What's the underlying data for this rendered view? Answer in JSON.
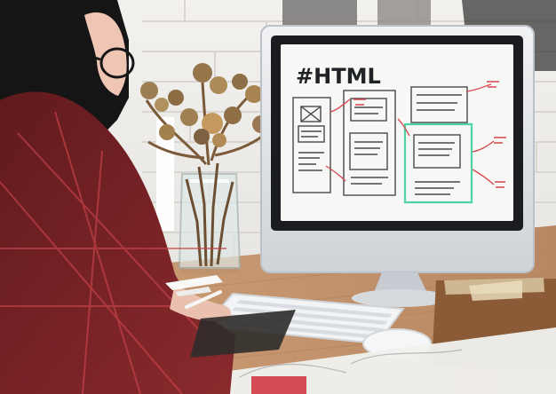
{
  "scene": {
    "screen_title": "#HTML"
  },
  "palette": {
    "brick_wall": "#ecebe7",
    "desk_wood": "#c99b72",
    "shirt_red": "#7f2427",
    "monitor_silver": "#d6d9dc",
    "screen_white": "#f7f7f5",
    "sketch_green": "#4dd3a5",
    "sketch_red": "#d4454c",
    "plant_dry": "#8d6c43"
  }
}
